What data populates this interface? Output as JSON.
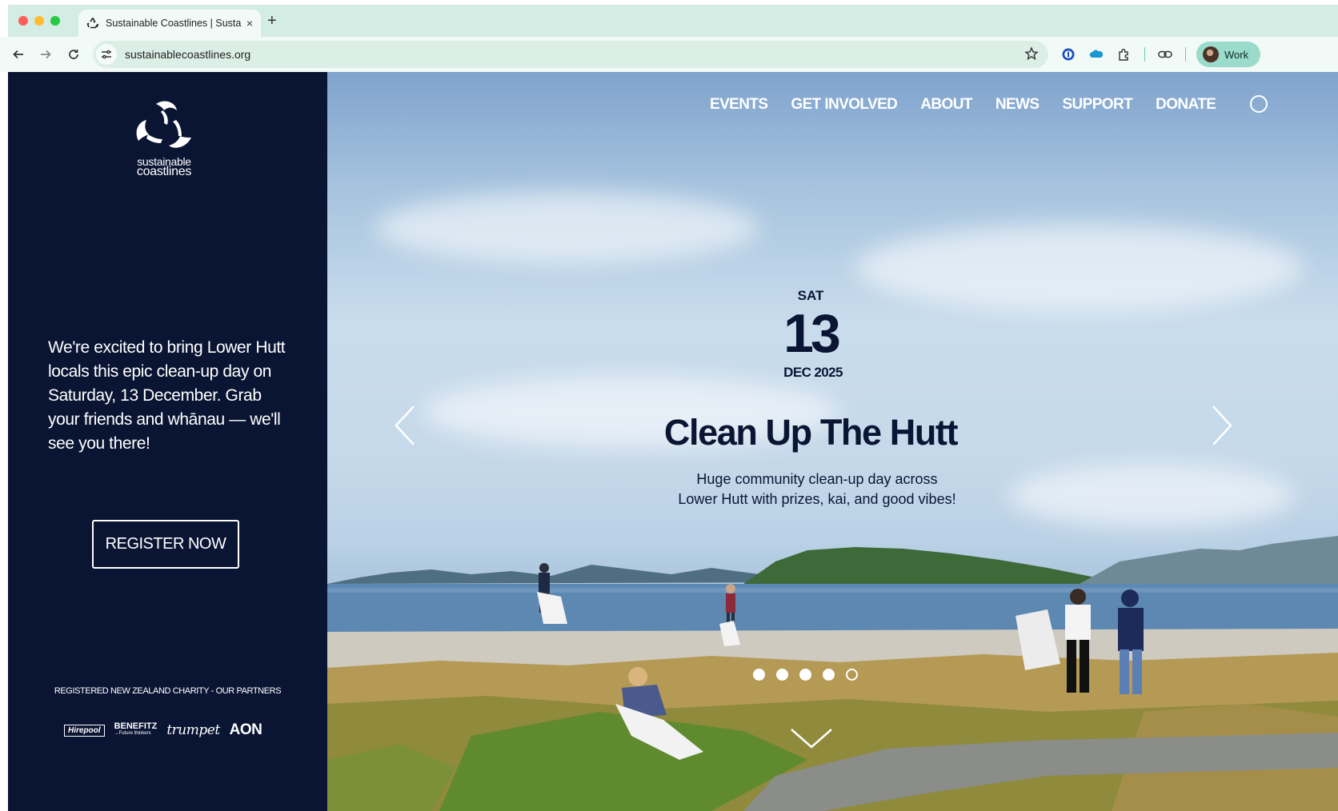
{
  "browser": {
    "tab_title": "Sustainable Coastlines | Susta",
    "tab_close": "×",
    "new_tab": "+",
    "url": "sustainablecoastlines.org",
    "profile_label": "Work"
  },
  "sidebar": {
    "logo_line1": "sustainable",
    "logo_line2": "coastlines",
    "intro": "We're excited to bring Lower Hutt locals this epic clean-up day on Saturday, 13 December. Grab your friends and whānau — we'll see you there!",
    "register_label": "REGISTER NOW",
    "partners_title": "REGISTERED NEW ZEALAND CHARITY - OUR PARTNERS",
    "partners": {
      "hirepool": "Hirepool",
      "benefitz": "BENEFITZ",
      "benefitz_tagline": "→Future thinkers",
      "trumpet": "trumpet",
      "aon": "AON"
    }
  },
  "nav": {
    "items": [
      "EVENTS",
      "GET INVOLVED",
      "ABOUT",
      "NEWS",
      "SUPPORT",
      "DONATE"
    ]
  },
  "hero": {
    "day": "SAT",
    "date": "13",
    "month_year": "DEC 2025",
    "title": "Clean Up The Hutt",
    "subtitle_line1": "Huge community clean-up day across",
    "subtitle_line2": "Lower Hutt with prizes, kai, and good vibes!",
    "slide_count": 5,
    "active_slide": 5
  },
  "colors": {
    "sidebar_bg": "#0a1533",
    "tabbar_bg": "#d3ece4",
    "toolbar_bg": "#f2faf7",
    "text_navy": "#0a1533"
  }
}
